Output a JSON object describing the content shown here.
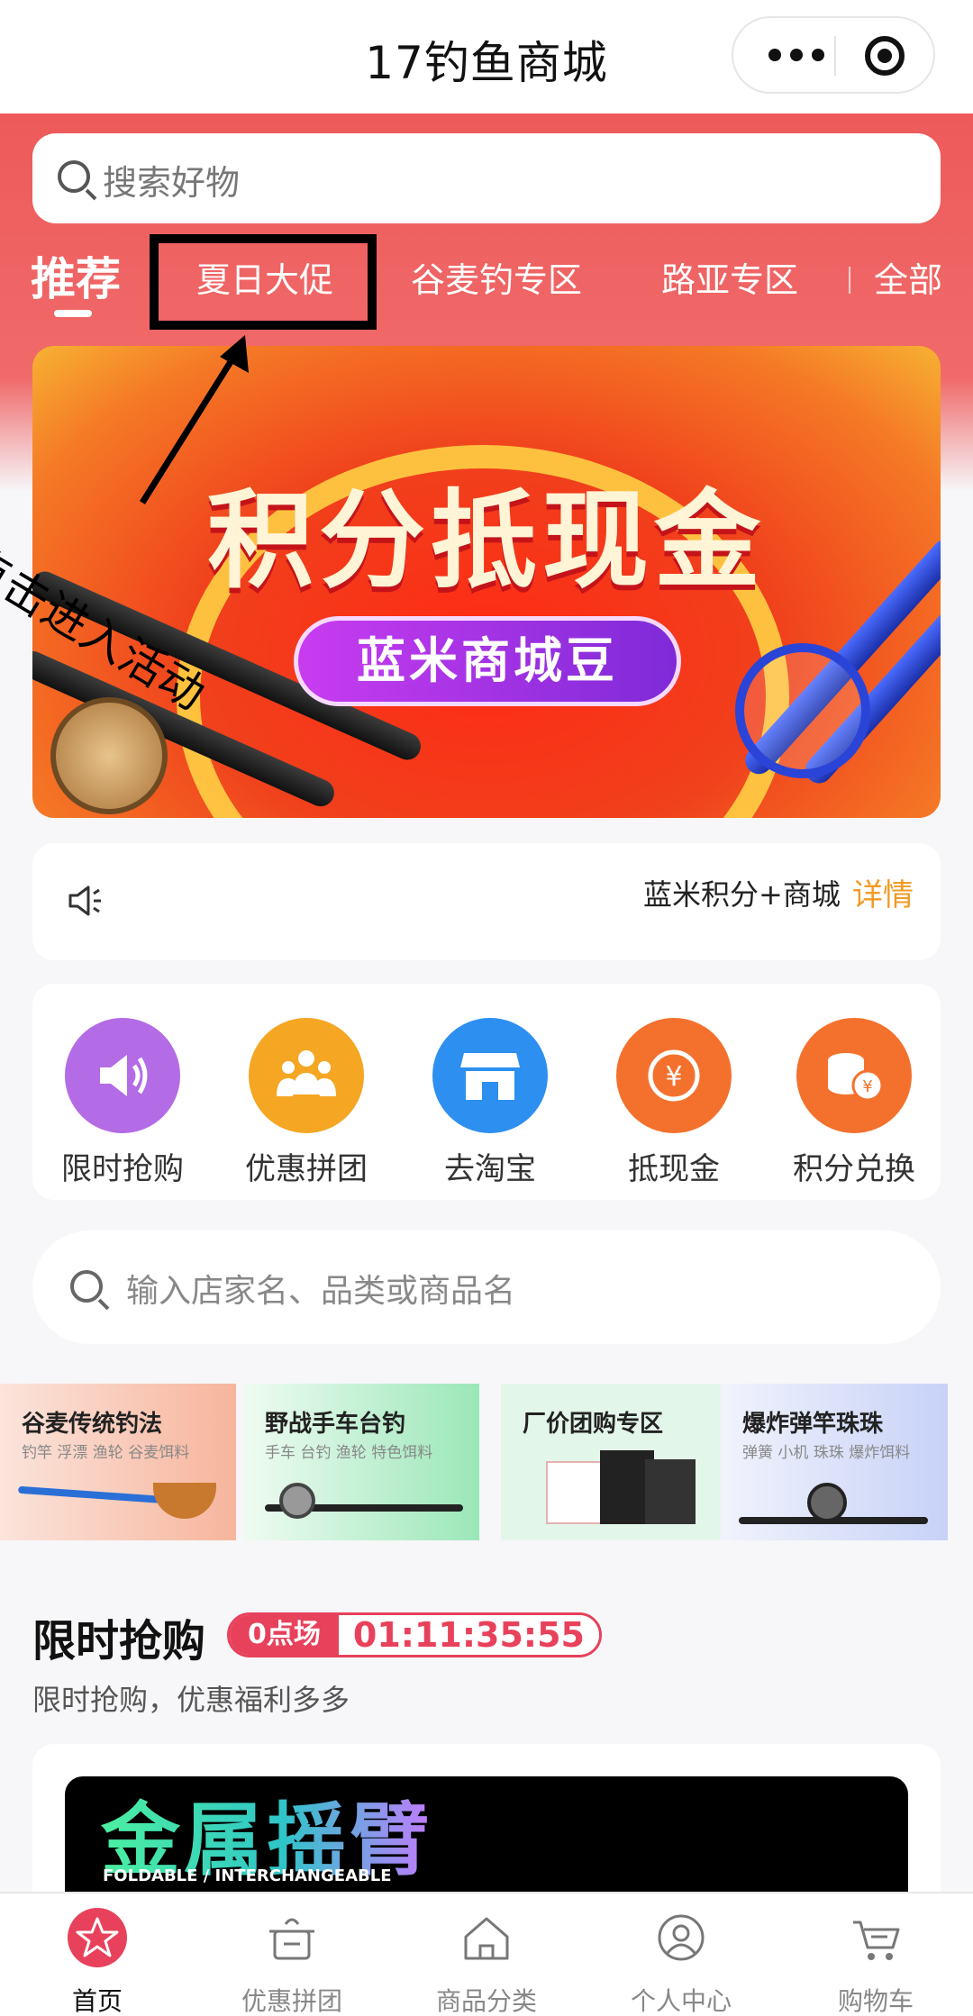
{
  "nav": {
    "title": "17钓鱼商城"
  },
  "search": {
    "placeholder": "搜索好物"
  },
  "tabs": [
    {
      "label": "推荐",
      "active": true
    },
    {
      "label": "夏日大促",
      "active": false
    },
    {
      "label": "谷麦钓专区",
      "active": false
    },
    {
      "label": "路亚专区",
      "active": false
    },
    {
      "label": "全部",
      "active": false
    }
  ],
  "banner": {
    "headline": "积分抵现金",
    "subtitle": "蓝米商城豆"
  },
  "annotation": {
    "text": "点击进入活动"
  },
  "notice": {
    "text": "蓝米积分+商城",
    "detail": "详情"
  },
  "quick_links": [
    {
      "label": "限时抢购",
      "icon": "speaker-icon",
      "color": "#b36be6"
    },
    {
      "label": "优惠拼团",
      "icon": "group-icon",
      "color": "#f5a623"
    },
    {
      "label": "去淘宝",
      "icon": "shop-icon",
      "color": "#2d8ff0"
    },
    {
      "label": "抵现金",
      "icon": "yen-coin-icon",
      "color": "#f4712d"
    },
    {
      "label": "积分兑换",
      "icon": "coins-icon",
      "color": "#f4712d"
    }
  ],
  "shop_search": {
    "placeholder": "输入店家名、品类或商品名"
  },
  "categories": [
    {
      "title": "谷麦传统钓法",
      "subtitle": "钓竿 浮漂 渔轮 谷麦饵料"
    },
    {
      "title": "野战手车台钓",
      "subtitle": "手车 台钓 渔轮 特色饵料"
    },
    {
      "title": "厂价团购专区",
      "subtitle": ""
    },
    {
      "title": "爆炸弹竿珠珠",
      "subtitle": "弹簧 小机 珠珠 爆炸饵料"
    }
  ],
  "flash_sale": {
    "title": "限时抢购",
    "session": "0点场",
    "countdown": "01:11:35:55",
    "subtitle": "限时抢购，优惠福利多多",
    "product_headline": "金属摇臂",
    "product_tagline": "FOLDABLE / INTERCHANGEABLE"
  },
  "tabbar": [
    {
      "label": "首页",
      "icon": "home-star-icon",
      "active": true
    },
    {
      "label": "优惠拼团",
      "icon": "gift-pot-icon",
      "active": false
    },
    {
      "label": "商品分类",
      "icon": "house-icon",
      "active": false
    },
    {
      "label": "个人中心",
      "icon": "user-icon",
      "active": false
    },
    {
      "label": "购物车",
      "icon": "cart-icon",
      "active": false
    }
  ],
  "colors": {
    "header_red": "#ee5a5a",
    "accent_orange": "#f29a24",
    "flash_red": "#e8415b"
  }
}
